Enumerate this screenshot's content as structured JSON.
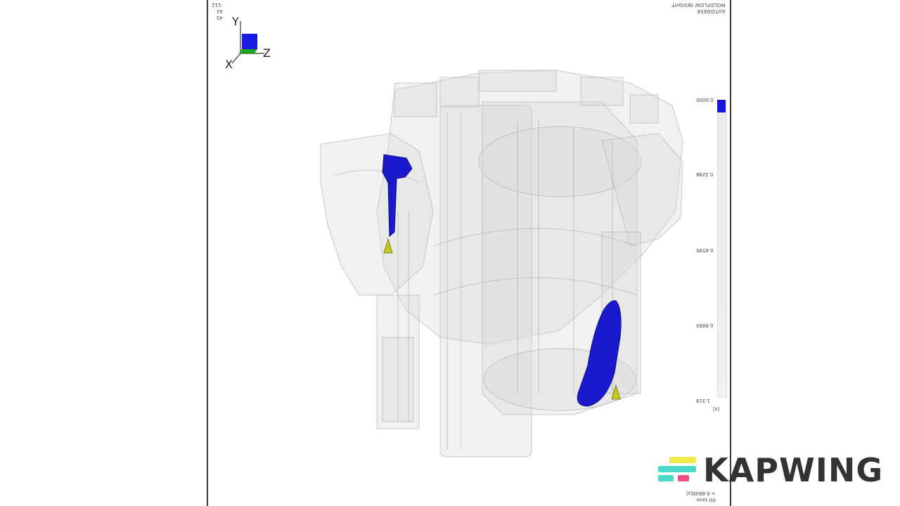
{
  "header": {
    "company": "AUTODESK",
    "product": "MOLDFLOW INSIGHT",
    "view_angles": [
      "45",
      "42",
      "-112"
    ]
  },
  "triad": {
    "x_label": "X",
    "y_label": "Y",
    "z_label": "Z"
  },
  "legend": {
    "ticks": [
      "0.0000",
      "0.3298",
      "0.6595",
      "0.9893",
      "1.319"
    ],
    "unit": "[s]",
    "top_color": "#1414d6"
  },
  "footer": {
    "result_name": "Fill time",
    "value_line": "= 0.6600[s]"
  },
  "watermark": {
    "text": "KAPWING",
    "colors": [
      "#f2e94e",
      "#4ad9c6",
      "#e94f86"
    ]
  }
}
